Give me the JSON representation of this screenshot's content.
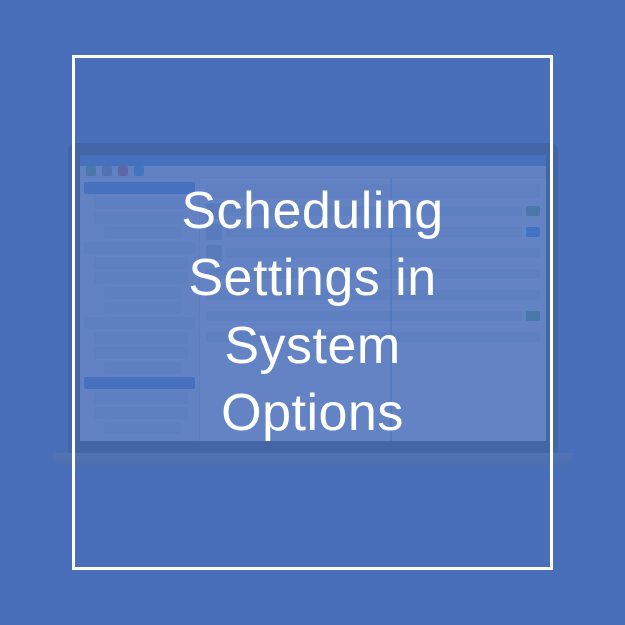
{
  "card": {
    "title": "Scheduling\nSettings in\nSystem\nOptions"
  }
}
